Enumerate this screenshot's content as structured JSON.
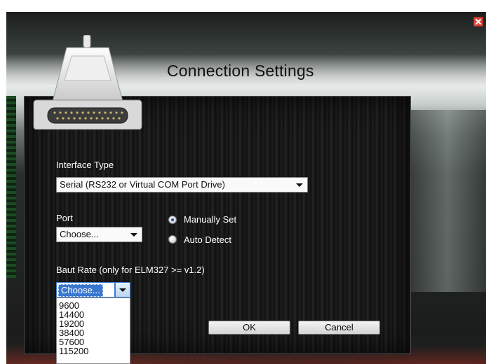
{
  "dialog": {
    "title": "Connection Settings"
  },
  "interface_type": {
    "label": "Interface Type",
    "value": "Serial (RS232 or Virtual COM Port Drive)"
  },
  "port": {
    "label": "Port",
    "value": "Choose...",
    "mode_options": [
      {
        "label": "Manually Set",
        "checked": true
      },
      {
        "label": "Auto Detect",
        "checked": false
      }
    ]
  },
  "baud_rate": {
    "label": "Baut Rate (only for ELM327 >= v1.2)",
    "value": "Choose...",
    "options": [
      "9600",
      "14400",
      "19200",
      "38400",
      "57600",
      "115200"
    ]
  },
  "buttons": {
    "ok": "OK",
    "cancel": "Cancel"
  },
  "icons": {
    "close": "close-icon",
    "connector": "serial-connector-icon"
  },
  "colors": {
    "selection": "#3a78d0",
    "panel_bg": "#151515",
    "close_red": "#d8443a"
  }
}
